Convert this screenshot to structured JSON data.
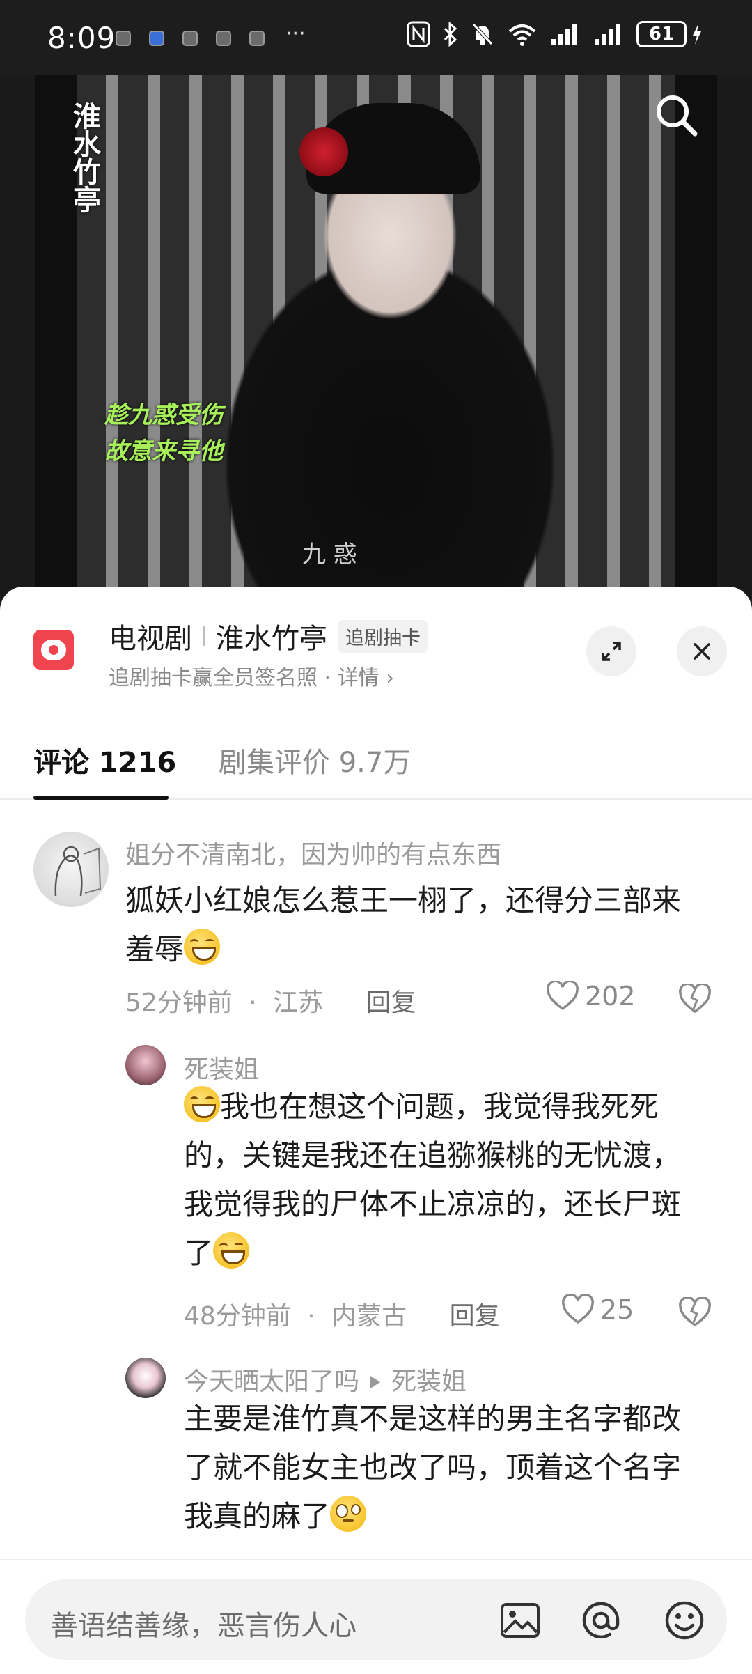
{
  "status_bar": {
    "time": "8:09",
    "more": "···",
    "battery": "61"
  },
  "video": {
    "logo": "淮水竹亭",
    "caption_line1": "趁九惑受伤",
    "caption_line2": "故意来寻他",
    "subtitle_char": "九  惑"
  },
  "header": {
    "category": "电视剧",
    "title": "淮水竹亭",
    "tag": "追剧抽卡",
    "subtitle": "追剧抽卡赢全员签名照 · 详情 ›"
  },
  "tabs": [
    {
      "label": "评论 1216"
    },
    {
      "label": "剧集评价 9.7万"
    }
  ],
  "comments": [
    {
      "user": "姐分不清南北，因为帅的有点东西",
      "text_line1": "狐妖小红娘怎么惹王一栩了，还得分三部来",
      "text_line2": "羞辱",
      "time": "52分钟前",
      "location": "江苏",
      "reply": "回复",
      "likes": "202"
    },
    {
      "user": "死装姐",
      "text_line1": "我也在想这个问题，我觉得我死死",
      "text_line2": "的，关键是我还在追猕猴桃的无忧渡，",
      "text_line3": "我觉得我的尸体不止凉凉的，还长尸斑",
      "text_line4": "了",
      "time": "48分钟前",
      "location": "内蒙古",
      "reply": "回复",
      "likes": "25"
    },
    {
      "user": "今天晒太阳了吗",
      "reply_to": "死装姐",
      "text_line1": "主要是淮竹真不是这样的男主名字都改",
      "text_line2": "了就不能女主也改了吗，顶着这个名字",
      "text_line3": "我真的麻了"
    }
  ],
  "input": {
    "placeholder": "善语结善缘，恶言伤人心"
  },
  "colors": {
    "accent_red": "#f0454f",
    "text_primary": "#1b1b1b",
    "text_secondary": "#9a9a9a",
    "caption_green": "#a7f05a"
  }
}
